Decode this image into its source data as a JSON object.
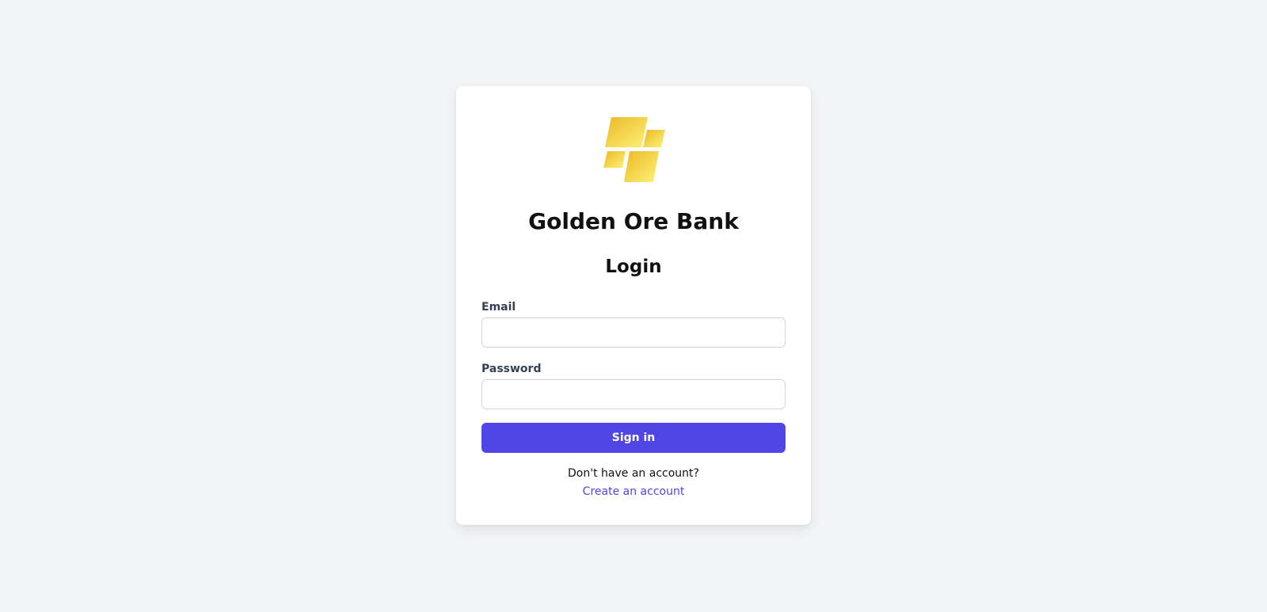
{
  "brand": {
    "name": "Golden Ore Bank",
    "logo_icon": "gold-bars-icon",
    "logo_colors": [
      "#f0c12f",
      "#fff176"
    ]
  },
  "form": {
    "title": "Login",
    "email_label": "Email",
    "email_value": "",
    "password_label": "Password",
    "password_value": "",
    "submit_label": "Sign in"
  },
  "footer": {
    "prompt": "Don't have an account?",
    "link_label": "Create an account"
  },
  "colors": {
    "background": "#f3f4f6",
    "accent": "#4f46e5",
    "card": "#ffffff"
  }
}
